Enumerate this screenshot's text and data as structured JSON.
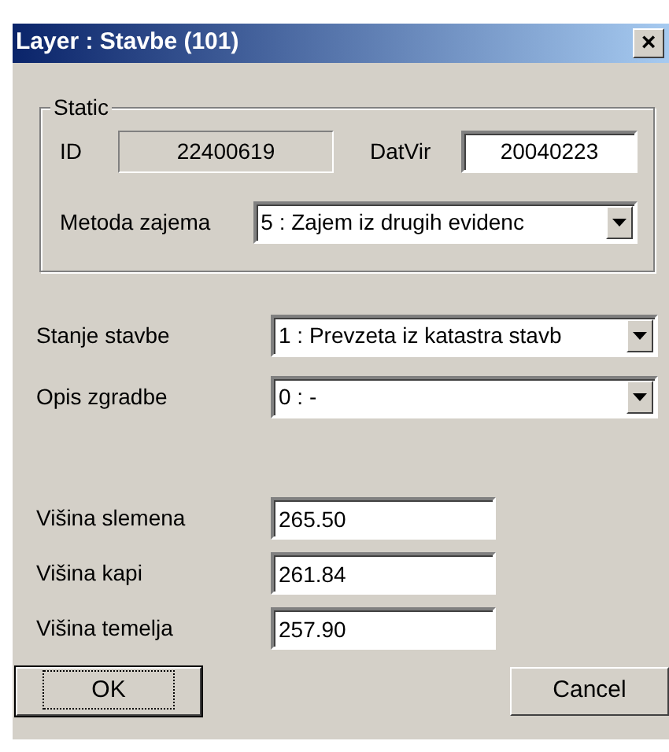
{
  "window": {
    "title": "Layer : Stavbe (101)",
    "close": "×"
  },
  "group": {
    "legend": "Static",
    "id": {
      "label": "ID",
      "value": "22400619",
      "disabled": true
    },
    "datvir": {
      "label": "DatVir",
      "value": "20040223"
    },
    "metoda": {
      "label": "Metoda zajema",
      "value": "5 : Zajem iz drugih evidenc"
    }
  },
  "combos": [
    {
      "label": "Stanje stavbe",
      "value": "1 : Prevzeta iz katastra stavb"
    },
    {
      "label": "Opis zgradbe",
      "value": "0 :  -"
    }
  ],
  "fields": [
    {
      "label": "Višina slemena",
      "value": "265.50"
    },
    {
      "label": "Višina kapi",
      "value": "261.84"
    },
    {
      "label": "Višina temelja",
      "value": "257.90"
    }
  ],
  "buttons": [
    {
      "label": "OK",
      "default": true
    },
    {
      "label": "Cancel",
      "default": false
    }
  ]
}
